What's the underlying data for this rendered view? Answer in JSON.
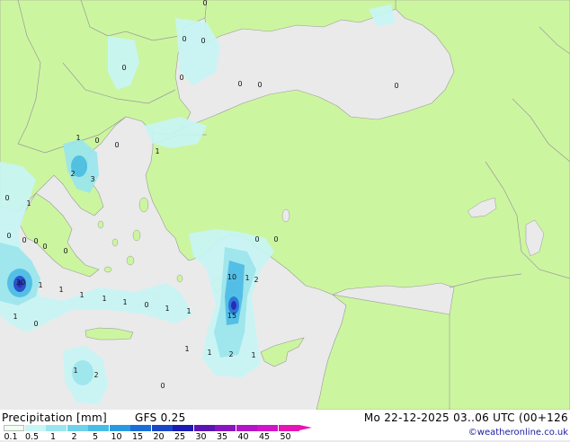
{
  "footer": {
    "title": "Precipitation [mm]",
    "model": "GFS 0.25",
    "datetime": "Mo 22-12-2025 03..06 UTC (00+126",
    "credit": "©weatheronline.co.uk"
  },
  "legend": {
    "ticks": [
      "0.1",
      "0.5",
      "1",
      "2",
      "5",
      "10",
      "15",
      "20",
      "25",
      "30",
      "35",
      "40",
      "45",
      "50"
    ],
    "colors": [
      "#f0fff0",
      "#c8f5f5",
      "#9ae6ee",
      "#6ed2ea",
      "#48bce6",
      "#2a9ae0",
      "#1a6ed6",
      "#1a46c8",
      "#1a1ab4",
      "#5a14b4",
      "#8a14c0",
      "#b414c8",
      "#d214c8",
      "#e614b4"
    ]
  },
  "map_labels": [
    "0",
    "0",
    "0",
    "0",
    "0",
    "0",
    "0",
    "0",
    "1",
    "0",
    "0",
    "1",
    "2",
    "3",
    "0",
    "1",
    "0",
    "0",
    "0",
    "0",
    "0",
    "0",
    "0",
    "30",
    "1",
    "1",
    "1",
    "1",
    "1",
    "1",
    "0",
    "1",
    "2",
    "1",
    "0",
    "10",
    "1",
    "15",
    "1",
    "1",
    "2",
    "1",
    "0",
    "1",
    "2"
  ],
  "colors": {
    "land": "#ccf5a0",
    "sea": "#eaeaea",
    "border": "#9a9a9a",
    "light_precip": "#c8f5f5",
    "medium_precip": "#9ae6ee",
    "heavy_precip": "#48bce6"
  }
}
